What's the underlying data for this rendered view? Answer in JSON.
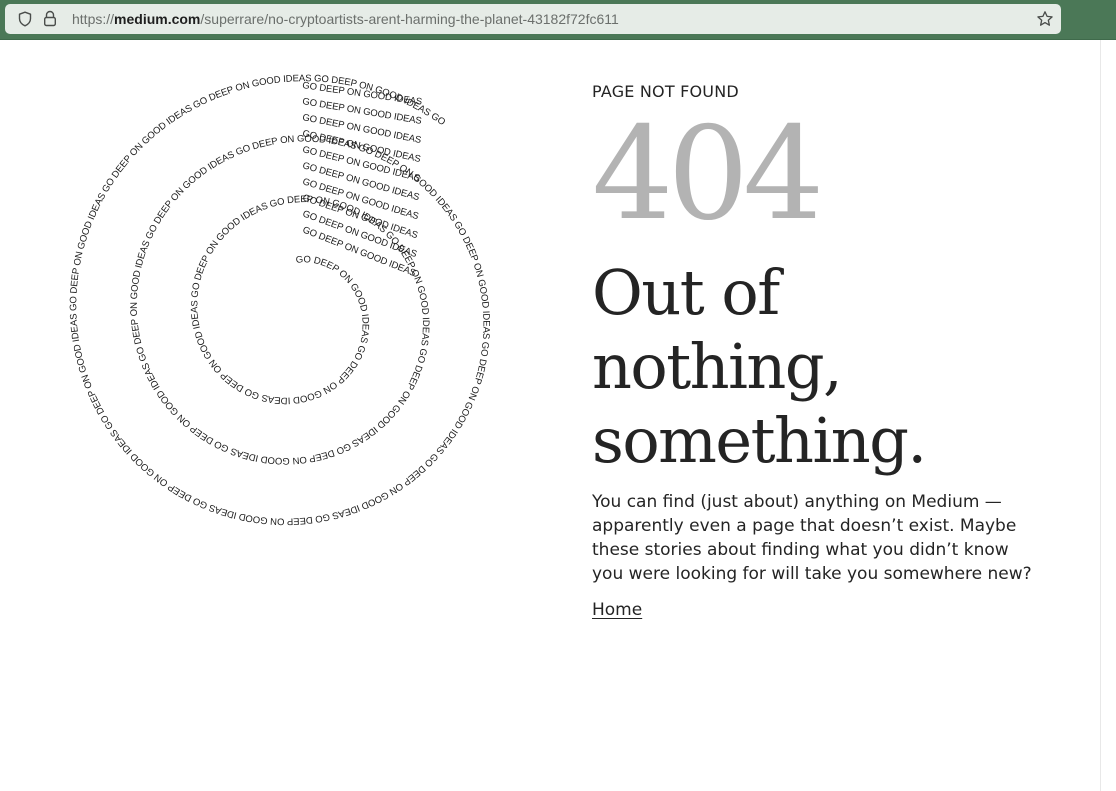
{
  "browser": {
    "url_prefix": "https://",
    "url_host": "medium.com",
    "url_path": "/superrare/no-cryptoartists-arent-harming-the-planet-43182f72fc611",
    "icons": [
      "shield-icon",
      "lock-icon",
      "star-bookmark-icon"
    ],
    "bar_color": "#4b7857"
  },
  "illustration": {
    "phrase": "GO DEEP ON GOOD IDEAS"
  },
  "main": {
    "eyebrow": "PAGE NOT FOUND",
    "code": "404",
    "headline_lines": [
      "Out of",
      "nothing,",
      "something."
    ],
    "body": "You can find (just about) anything on Medium — apparently even a page that doesn’t exist. Maybe these stories about finding what you didn’t know you were looking for will take you somewhere new?",
    "home_link": "Home"
  },
  "colors": {
    "text": "#242424",
    "code_gray": "#b3b3b3"
  }
}
